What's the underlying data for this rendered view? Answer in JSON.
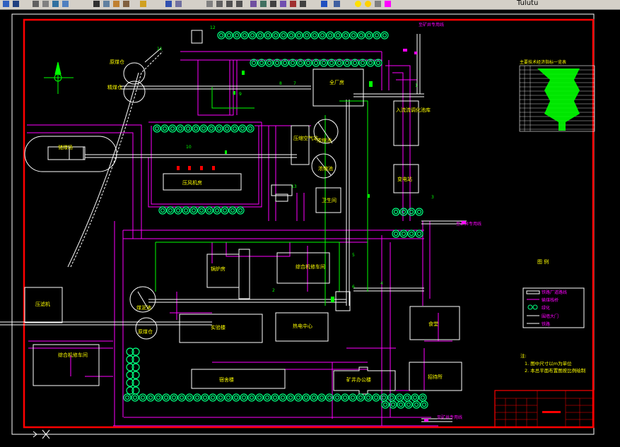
{
  "toolbar": {
    "buttons": [
      "new-icon",
      "save-icon",
      "print-icon",
      "preview-icon",
      "plot-icon",
      "publish-icon",
      "cut-icon",
      "copy-icon",
      "paste-icon",
      "match-icon",
      "brush-icon",
      "undo-icon",
      "redo-icon",
      "pan-icon",
      "zoom-realtime-icon",
      "zoom-window-icon",
      "zoom-previous-icon",
      "properties-icon",
      "design-center-icon",
      "tool-palette-icon",
      "sheet-set-icon",
      "markup-icon",
      "calculator-icon",
      "help-icon",
      "layer-icon",
      "bulb-icon",
      "sun-icon",
      "lock-icon",
      "color-icon"
    ],
    "layer_name": "Tulutu"
  },
  "colors": {
    "background": "#000000",
    "border": "#ff0000",
    "road": "#ff00ff",
    "building": "#ffffff",
    "pipe": "#00ff00",
    "label": "#ffff00",
    "tree": "#00ff7f"
  },
  "labels": {
    "b1": "给水加压站",
    "b2": "全厂房",
    "b3": "入流流调化池库",
    "b4": "变电站",
    "b5": "压缩空气站",
    "b6": "厂房泵房",
    "b7": "锅炉房",
    "b8": "综合机修车间",
    "b9": "实验楼",
    "b10": "热电中心",
    "b11": "食堂",
    "b12": "宿舍楼",
    "b13": "矿井办公楼",
    "b14": "招待所",
    "b15": "压滤机",
    "b16": "综合机修车间",
    "b17": "储煤场",
    "b18": "原煤仓",
    "b19": "精煤仓",
    "b20": "浓缩池",
    "b21": "浓缩池",
    "b22": "卫生间",
    "b23": "压风机房",
    "b24": "煤泥池",
    "b25": "原煤仓",
    "r1": "至矿井专用线",
    "r2": "至矿井专用线",
    "r3": "至矿井专用线",
    "r4": "至矿井专用线"
  },
  "numbers": {
    "n1": "1",
    "n2": "2",
    "n3": "3",
    "n4": "4",
    "n5": "5",
    "n6": "6",
    "n7": "7",
    "n8": "8",
    "n9": "9",
    "n10": "10",
    "n11": "11",
    "n12": "12",
    "n13": "13",
    "n14": "14",
    "n15": "15",
    "n16": "16"
  },
  "legend": {
    "title": "图 例",
    "items": [
      "铁路厂道路线",
      "输煤栈桥",
      "绿化",
      "围墙大门",
      "铁路"
    ]
  },
  "notes": {
    "title": "注:",
    "line1": "1. 图中尺寸以m为单位",
    "line2": "2. 本总平面布置图按比例绘制"
  },
  "tables": {
    "technical_title": "主要技术经济指标一览表"
  }
}
